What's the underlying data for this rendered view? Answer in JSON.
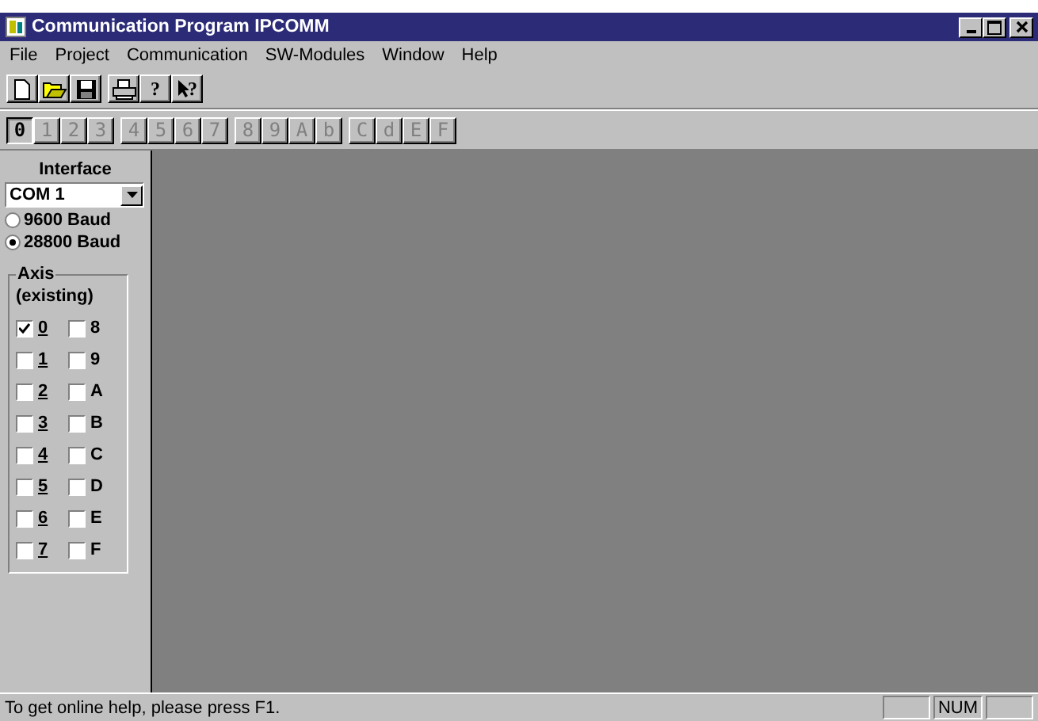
{
  "window": {
    "title": "Communication Program IPCOMM"
  },
  "menu": [
    "File",
    "Project",
    "Communication",
    "SW-Modules",
    "Window",
    "Help"
  ],
  "toolbar": [
    [
      {
        "kind": "new"
      },
      {
        "kind": "open"
      },
      {
        "kind": "save"
      }
    ],
    [
      {
        "kind": "print"
      },
      {
        "kind": "help",
        "glyph": "?"
      },
      {
        "kind": "context-help",
        "glyph": "?"
      }
    ]
  ],
  "axis_toolbar": [
    {
      "label": "0",
      "selected": true
    },
    {
      "label": "1",
      "selected": false
    },
    {
      "label": "2",
      "selected": false
    },
    {
      "label": "3",
      "selected": false
    },
    {
      "label": "4",
      "selected": false
    },
    {
      "label": "5",
      "selected": false
    },
    {
      "label": "6",
      "selected": false
    },
    {
      "label": "7",
      "selected": false
    },
    {
      "label": "8",
      "selected": false
    },
    {
      "label": "9",
      "selected": false
    },
    {
      "label": "A",
      "selected": false
    },
    {
      "label": "b",
      "selected": false
    },
    {
      "label": "C",
      "selected": false
    },
    {
      "label": "d",
      "selected": false
    },
    {
      "label": "E",
      "selected": false
    },
    {
      "label": "F",
      "selected": false
    }
  ],
  "sidebar": {
    "interface_label": "Interface",
    "port": "COM 1",
    "baud": [
      {
        "label": "9600 Baud",
        "selected": false
      },
      {
        "label": "28800 Baud",
        "selected": true
      }
    ],
    "axis_group": {
      "title": "Axis",
      "subtitle": "(existing)",
      "axes": [
        {
          "label": "0",
          "checked": true
        },
        {
          "label": "1",
          "checked": false
        },
        {
          "label": "2",
          "checked": false
        },
        {
          "label": "3",
          "checked": false
        },
        {
          "label": "4",
          "checked": false
        },
        {
          "label": "5",
          "checked": false
        },
        {
          "label": "6",
          "checked": false
        },
        {
          "label": "7",
          "checked": false
        },
        {
          "label": "8",
          "checked": false
        },
        {
          "label": "9",
          "checked": false
        },
        {
          "label": "A",
          "checked": false
        },
        {
          "label": "B",
          "checked": false
        },
        {
          "label": "C",
          "checked": false
        },
        {
          "label": "D",
          "checked": false
        },
        {
          "label": "E",
          "checked": false
        },
        {
          "label": "F",
          "checked": false
        }
      ]
    }
  },
  "status_bar": {
    "message": "To get online help, please press F1.",
    "indicators": [
      {
        "kind": "blank"
      },
      {
        "kind": "text",
        "label": "NUM"
      },
      {
        "kind": "blank"
      }
    ]
  }
}
